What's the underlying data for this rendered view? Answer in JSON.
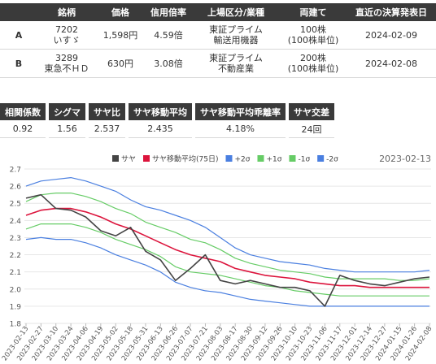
{
  "pairs_table": {
    "headers": [
      "",
      "銘柄",
      "価格",
      "信用倍率",
      "上場区分/業種",
      "両建て",
      "直近の決算発表日"
    ],
    "rows": [
      {
        "label": "A",
        "code": "7202",
        "name": "いすゞ",
        "price": "1,598円",
        "margin_ratio": "4.59倍",
        "market": "東証プライム",
        "industry": "輸送用機器",
        "both_sides": "100株",
        "unit": "(100株単位)",
        "earnings_date": "2024-02-09"
      },
      {
        "label": "B",
        "code": "3289",
        "name": "東急不ＨＤ",
        "price": "630円",
        "margin_ratio": "3.08倍",
        "market": "東証プライム",
        "industry": "不動産業",
        "both_sides": "200株",
        "unit": "(100株単位)",
        "earnings_date": "2024-02-08"
      }
    ]
  },
  "stats_table": {
    "headers": [
      "相関係数",
      "シグマ",
      "サヤ比",
      "サヤ移動平均",
      "サヤ移動平均乖離率",
      "サヤ交差"
    ],
    "values": [
      "0.92",
      "1.56",
      "2.537",
      "2.435",
      "4.18%",
      "24回"
    ]
  },
  "chart_data": {
    "type": "line",
    "date_label": "2023-02-13",
    "legend": [
      {
        "name": "サヤ",
        "color": "#444444"
      },
      {
        "name": "サヤ移動平均(75日)",
        "color": "#dc143c"
      },
      {
        "name": "+2σ",
        "color": "#4a7fe0"
      },
      {
        "name": "+1σ",
        "color": "#66cc66"
      },
      {
        "name": "-1σ",
        "color": "#66cc66"
      },
      {
        "name": "-2σ",
        "color": "#4a7fe0"
      }
    ],
    "ylim": [
      1.8,
      2.7
    ],
    "yticks": [
      "1.8",
      "1.9",
      "2.0",
      "2.1",
      "2.2",
      "2.3",
      "2.4",
      "2.5",
      "2.6",
      "2.7"
    ],
    "x": [
      "2023-02-13",
      "2023-02-27",
      "2023-03-10",
      "2023-03-24",
      "2023-04-06",
      "2023-04-19",
      "2023-05-02",
      "2023-05-18",
      "2023-05-31",
      "2023-06-13",
      "2023-06-26",
      "2023-07-07",
      "2023-07-21",
      "2023-08-03",
      "2023-08-17",
      "2023-08-30",
      "2023-09-12",
      "2023-09-26",
      "2023-10-10",
      "2023-10-23",
      "2023-11-06",
      "2023-11-17",
      "2023-12-01",
      "2023-12-14",
      "2023-12-27",
      "2024-01-15",
      "2024-01-26",
      "2024-02-08"
    ],
    "series": [
      {
        "name": "サヤ",
        "color": "#444444",
        "values": [
          2.53,
          2.55,
          2.47,
          2.46,
          2.42,
          2.34,
          2.31,
          2.36,
          2.22,
          2.17,
          2.05,
          2.12,
          2.2,
          2.05,
          2.03,
          2.05,
          2.03,
          2.01,
          2.01,
          1.99,
          1.9,
          2.08,
          2.05,
          2.03,
          2.02,
          2.04,
          2.06,
          2.07
        ]
      },
      {
        "name": "サヤ移動平均(75日)",
        "color": "#dc143c",
        "values": [
          2.43,
          2.46,
          2.47,
          2.47,
          2.45,
          2.42,
          2.38,
          2.35,
          2.31,
          2.27,
          2.23,
          2.2,
          2.18,
          2.16,
          2.12,
          2.1,
          2.08,
          2.07,
          2.06,
          2.04,
          2.03,
          2.02,
          2.02,
          2.01,
          2.01,
          2.01,
          2.01,
          2.01
        ]
      },
      {
        "name": "+2σ",
        "color": "#4a7fe0",
        "values": [
          2.6,
          2.63,
          2.64,
          2.65,
          2.63,
          2.6,
          2.57,
          2.52,
          2.48,
          2.46,
          2.43,
          2.4,
          2.36,
          2.3,
          2.24,
          2.2,
          2.18,
          2.16,
          2.15,
          2.14,
          2.12,
          2.11,
          2.1,
          2.1,
          2.1,
          2.1,
          2.1,
          2.11
        ]
      },
      {
        "name": "+1σ",
        "color": "#66cc66",
        "values": [
          2.51,
          2.55,
          2.56,
          2.56,
          2.54,
          2.51,
          2.47,
          2.44,
          2.39,
          2.36,
          2.33,
          2.29,
          2.27,
          2.23,
          2.18,
          2.15,
          2.13,
          2.11,
          2.1,
          2.09,
          2.07,
          2.06,
          2.06,
          2.06,
          2.06,
          2.05,
          2.05,
          2.06
        ]
      },
      {
        "name": "-1σ",
        "color": "#66cc66",
        "values": [
          2.35,
          2.38,
          2.38,
          2.38,
          2.36,
          2.33,
          2.29,
          2.26,
          2.23,
          2.19,
          2.13,
          2.1,
          2.09,
          2.08,
          2.06,
          2.04,
          2.02,
          2.01,
          1.99,
          1.98,
          1.97,
          1.96,
          1.96,
          1.96,
          1.96,
          1.96,
          1.96,
          1.96
        ]
      },
      {
        "name": "-2σ",
        "color": "#4a7fe0",
        "values": [
          2.29,
          2.3,
          2.29,
          2.29,
          2.27,
          2.24,
          2.2,
          2.17,
          2.14,
          2.1,
          2.04,
          2.01,
          1.99,
          1.98,
          1.96,
          1.94,
          1.93,
          1.92,
          1.91,
          1.9,
          1.9,
          1.9,
          1.9,
          1.9,
          1.9,
          1.9,
          1.9,
          1.9
        ]
      }
    ]
  }
}
